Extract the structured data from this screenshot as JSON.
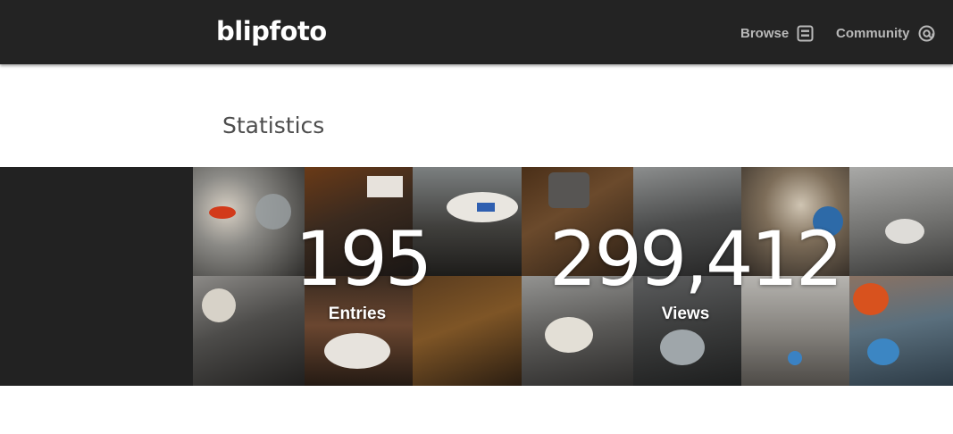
{
  "header": {
    "logo": "blipfoto",
    "nav": [
      {
        "label": "Browse",
        "icon": "browse-grid-icon"
      },
      {
        "label": "Community",
        "icon": "community-at-icon"
      }
    ]
  },
  "page": {
    "title": "Statistics"
  },
  "stats": [
    {
      "value": "195",
      "label": "Entries"
    },
    {
      "value": "299,412",
      "label": "Views"
    }
  ],
  "colors": {
    "header_bg": "#232323",
    "band_bg": "#222222",
    "nav_text": "#b9b9b9",
    "title_text": "#4d4d4d"
  }
}
